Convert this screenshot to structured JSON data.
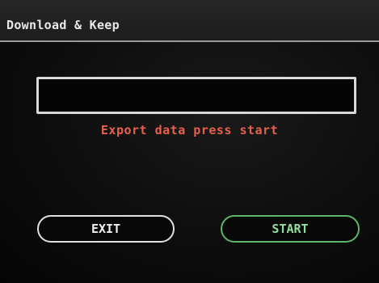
{
  "header": {
    "title": "Download & Keep"
  },
  "main": {
    "data_field_value": "",
    "message": "Export data press start"
  },
  "buttons": {
    "exit_label": "EXIT",
    "start_label": "START"
  },
  "colors": {
    "background": "#0d0d0d",
    "message": "#e8604a",
    "exit_border": "#e0e0e0",
    "start_border": "#5fb56a",
    "start_text": "#8fe09a"
  }
}
